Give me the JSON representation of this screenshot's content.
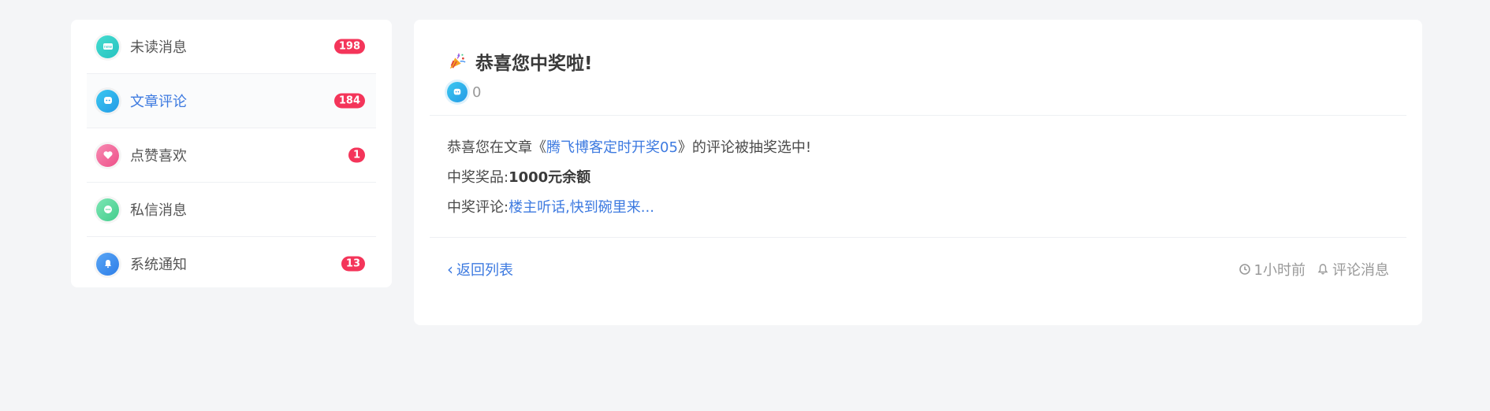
{
  "sidebar": {
    "items": [
      {
        "label": "未读消息",
        "icon": "message-icon",
        "badge": "198",
        "color": "#35d0c8"
      },
      {
        "label": "文章评论",
        "icon": "comment-icon",
        "badge": "184",
        "color": "#29b0ee",
        "active": true
      },
      {
        "label": "点赞喜欢",
        "icon": "heart-icon",
        "badge": "1",
        "color": "#f0679a"
      },
      {
        "label": "私信消息",
        "icon": "chat-icon",
        "badge": "",
        "color": "#5fd99a"
      },
      {
        "label": "系统通知",
        "icon": "bell-icon",
        "badge": "13",
        "color": "#3d8ef0"
      }
    ]
  },
  "detail": {
    "title": "恭喜您中奖啦!",
    "title_icon": "party-popper-icon",
    "comment_count": "0",
    "body": {
      "line1_prefix": "恭喜您在文章《",
      "article_title": "腾飞博客定时开奖05",
      "line1_suffix": "》的评论被抽奖选中!",
      "prize_label": "中奖奖品:",
      "prize_value": "1000元余额",
      "comment_label": "中奖评论:",
      "comment_value": "楼主听话,快到碗里来..."
    },
    "footer": {
      "back_label": "返回列表",
      "time": "1小时前",
      "category": "评论消息"
    }
  },
  "colors": {
    "accent": "#3d7ae0",
    "badge": "#f4355a",
    "background": "#f4f5f7"
  }
}
